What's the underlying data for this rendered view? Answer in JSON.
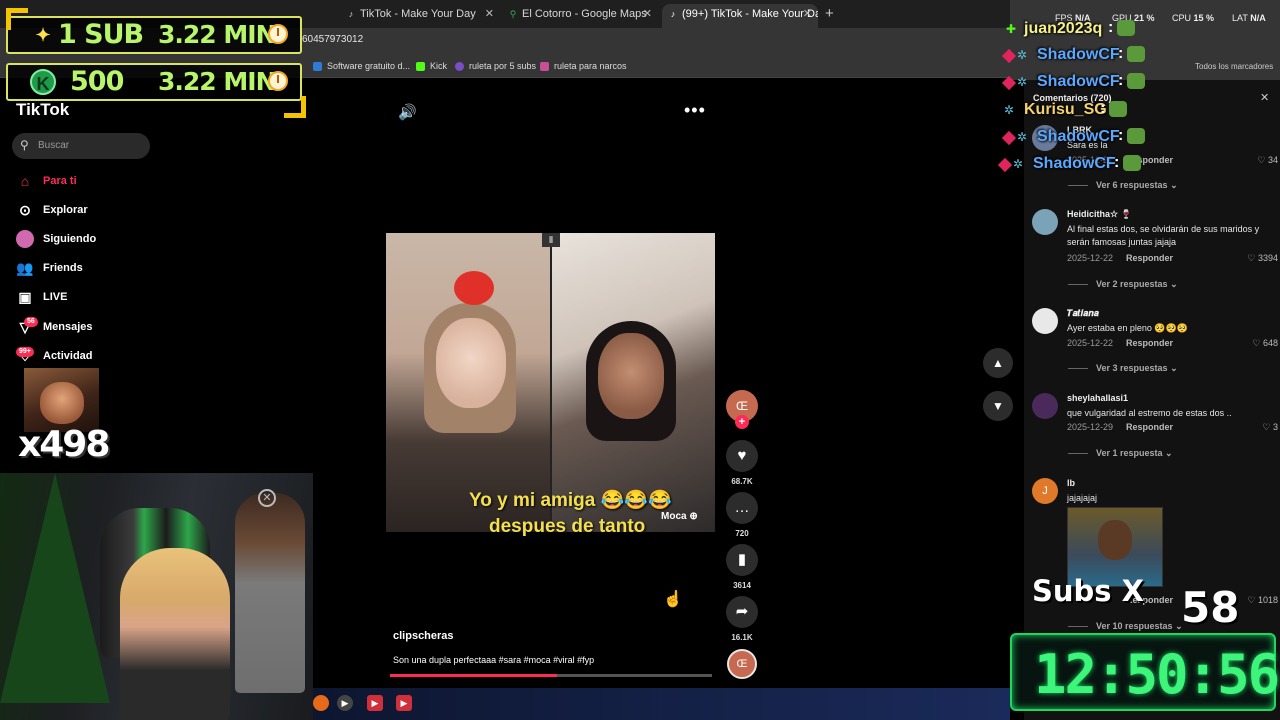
{
  "browser": {
    "tabs": [
      {
        "label": "TikTok - Make Your Day",
        "active": false
      },
      {
        "label": "El Cotorro - Google Maps",
        "active": false
      },
      {
        "label": "(99+) TikTok - Make Your Da",
        "active": true
      }
    ],
    "url_fragment": "60457973012",
    "bookmarks": [
      {
        "label": "Software gratuito d...",
        "color": "#2e7bd6"
      },
      {
        "label": "Kick",
        "color": "#53fc18"
      },
      {
        "label": "ruleta por 5 subs",
        "color": "#7a4ec9"
      },
      {
        "label": "ruleta para narcos",
        "color": "#c94e9a"
      }
    ],
    "all_bookmarks": "Todos los marcadores",
    "perf": {
      "fps_label": "FPS",
      "fps": "N/A",
      "gpu_label": "GPU",
      "gpu": "21 %",
      "cpu_label": "CPU",
      "cpu": "15 %",
      "lat_label": "LAT",
      "lat": "N/A"
    }
  },
  "overlay": {
    "goals": [
      {
        "label": "1 SUB",
        "time": "3.22 MIN",
        "icon": "sparkle-icon"
      },
      {
        "label": "500",
        "time": "3.22 MIN",
        "icon": "kick-coin-icon"
      }
    ],
    "multiplier": "x498",
    "subs_label": "Subs X",
    "subs_count": "58",
    "timer": "12:50:56"
  },
  "tiktok": {
    "logo": "TikTok",
    "search_placeholder": "Buscar",
    "nav": [
      {
        "label": "Para ti",
        "icon": "home-icon",
        "active": true
      },
      {
        "label": "Explorar",
        "icon": "compass-icon",
        "active": false
      },
      {
        "label": "Siguiendo",
        "icon": "following-avatar-icon",
        "active": false
      },
      {
        "label": "Friends",
        "icon": "friends-icon",
        "active": false
      },
      {
        "label": "LIVE",
        "icon": "live-icon",
        "active": false
      },
      {
        "label": "Mensajes",
        "icon": "messages-icon",
        "active": false,
        "badge": "56"
      },
      {
        "label": "Actividad",
        "icon": "activity-icon",
        "active": false,
        "badge": "99+"
      }
    ],
    "video": {
      "caption_line1": "Yo y mi amiga 😂😂😂",
      "caption_line2": "despues de tanto",
      "watermark": "Moca",
      "author": "clipscheras",
      "description": "Son una dupla perfectaaa #sara #moca #viral #fyp",
      "progress": 0.52
    },
    "actions": {
      "likes": "68.7K",
      "comments": "720",
      "saves": "3614",
      "shares": "16.1K"
    }
  },
  "comments": {
    "title": "Comentarios (720)",
    "items": [
      {
        "name": "Heidicitha☆ 🍷",
        "text": "Al final estas dos, se olvidarán de sus maridos y serán famosas juntas jajaja",
        "date": "2025-12-22",
        "reply": "Responder",
        "likes": "3394",
        "more": "Ver 2 respuestas",
        "avatar_color": "#7aa3b8"
      },
      {
        "name": "𝑻𝒂𝒕𝒊𝒂𝒏𝒂",
        "text": "Ayer estaba en pleno 🥺🥺🥺",
        "date": "2025-12-22",
        "reply": "Responder",
        "likes": "648",
        "more": "Ver 3 respuestas",
        "avatar_color": "#e8e8e8"
      },
      {
        "name": "sheylahallasi1",
        "text": "que vulgaridad al estremo de estas dos ..",
        "date": "2025-12-29",
        "reply": "Responder",
        "likes": "3",
        "more": "Ver 1 respuesta",
        "avatar_color": "#4a2a5a"
      },
      {
        "name": "lb",
        "text": "jajajajaj",
        "date": "",
        "reply": "Responder",
        "likes": "1018",
        "more": "Ver 10 respuestas",
        "avatar_color": "#e07a2a",
        "initial": "J"
      }
    ],
    "top": {
      "name": "Sara es la",
      "date": "2025-12-27",
      "reply": "Responder",
      "likes": "34",
      "more": "Ver 6 respuestas"
    },
    "partial_name": "LBRK"
  },
  "chat": [
    {
      "user": "juan2023q",
      "color": "#f5f08a",
      "emote": "facem"
    },
    {
      "user": "ShadowCF",
      "color": "#5aa8ff",
      "emote": "frog"
    },
    {
      "user": "ShadowCF",
      "color": "#5aa8ff",
      "emote": "frog"
    },
    {
      "user": "Kurisu_SG",
      "color": "#f5d36a",
      "emote": "facem"
    },
    {
      "user": "ShadowCF",
      "color": "#5aa8ff",
      "emote": "frog"
    },
    {
      "user": "ShadowCF",
      "color": "#5aa8ff",
      "emote": "frog"
    }
  ]
}
